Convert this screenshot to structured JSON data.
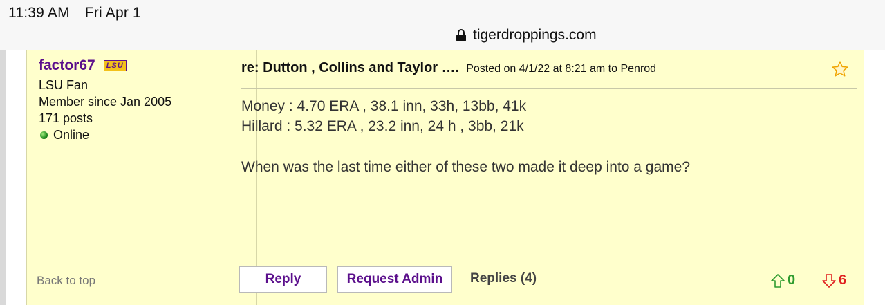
{
  "status_bar": {
    "time": "11:39 AM",
    "date": "Fri Apr 1"
  },
  "browser": {
    "domain": "tigerdroppings.com"
  },
  "user": {
    "username": "factor67",
    "team_badge": "LSU",
    "role": "LSU Fan",
    "member_since": "Member since Jan 2005",
    "posts": "171 posts",
    "status": "Online"
  },
  "post": {
    "title": "re: Dutton , Collins and Taylor ….",
    "meta": "Posted on 4/1/22 at 8:21 am to Penrod",
    "lines": [
      "Money : 4.70 ERA , 38.1 inn, 33h, 13bb, 41k",
      "Hillard : 5.32 ERA , 23.2 inn, 24 h , 3bb, 21k",
      "When was the last time either of these two made it deep into a game?"
    ]
  },
  "footer": {
    "back_to_top": "Back to top",
    "reply_label": "Reply",
    "request_admin_label": "Request Admin",
    "replies_label": "Replies (4)",
    "upvotes": "0",
    "downvotes": "6"
  },
  "colors": {
    "post_bg": "#ffffcc",
    "username": "#5b0f8c",
    "upvote": "#2e9b2e",
    "downvote": "#e02020"
  }
}
